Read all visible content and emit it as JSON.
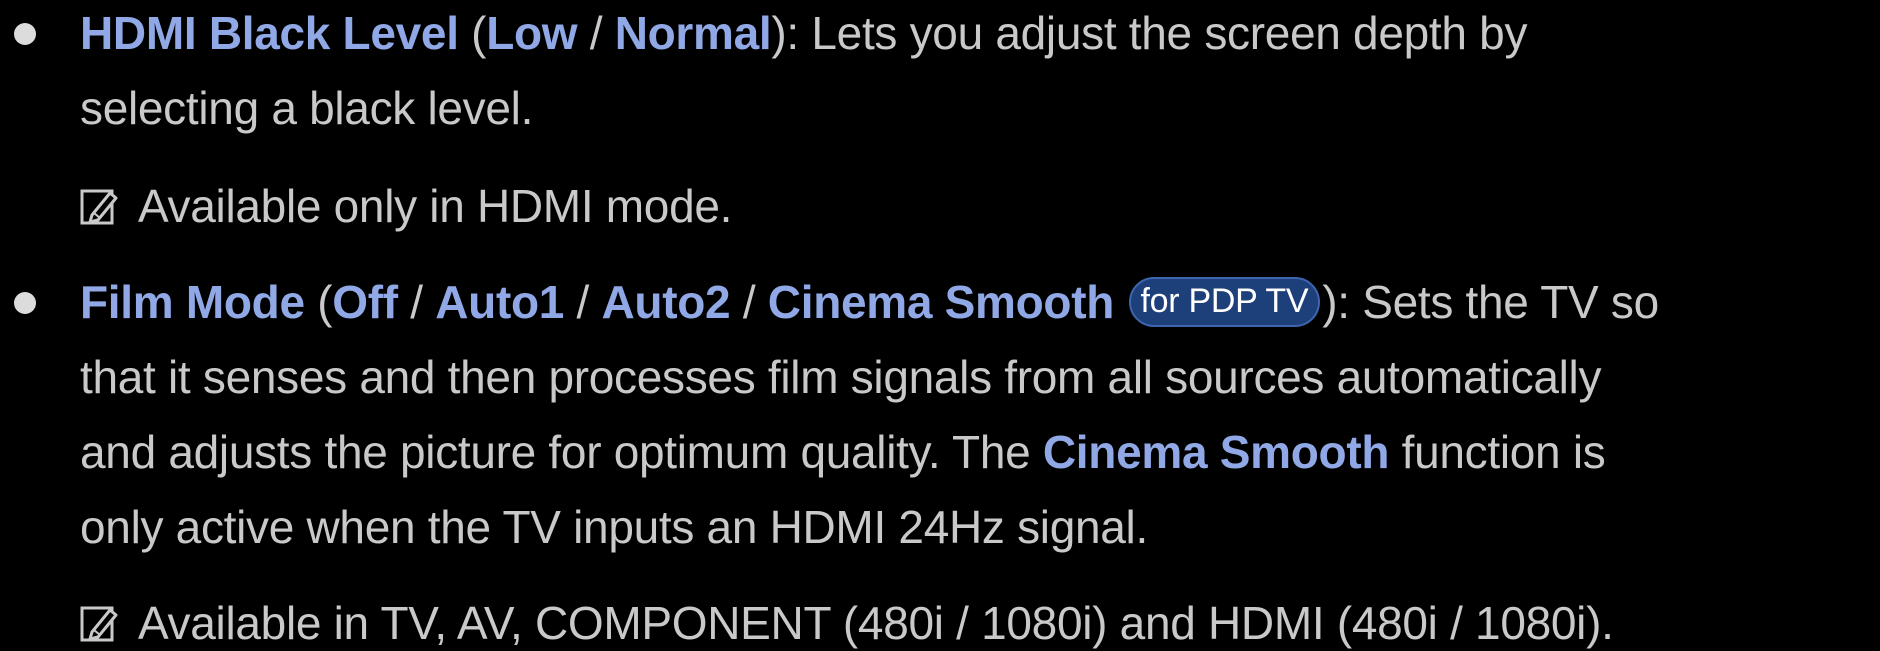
{
  "item1": {
    "title": "HDMI Black Level",
    "open": " (",
    "opt1": "Low",
    "sep1": " / ",
    "opt2": "Normal",
    "rest_line1": "): Lets you adjust the screen depth by",
    "line2": "selecting a black level."
  },
  "note1": {
    "icon": "note-pencil-icon",
    "text": "Available only in HDMI mode."
  },
  "item2": {
    "title": "Film Mode",
    "open": " (",
    "opt1": "Off",
    "sep1": " / ",
    "opt2": "Auto1",
    "sep2": " / ",
    "opt3": "Auto2",
    "sep3": " / ",
    "opt4": "Cinema Smooth",
    "badge": "for PDP TV",
    "rest_line1": "): Sets the TV so",
    "line2": "that it senses and then processes film signals from all sources automatically",
    "line3_pre": "and adjusts the picture for optimum quality. The ",
    "line3_hl": "Cinema Smooth",
    "line3_post": " function is",
    "line4": "only active when the TV inputs an HDMI 24Hz signal."
  },
  "note2": {
    "icon": "note-pencil-icon",
    "text": "Available in TV, AV, COMPONENT (480i / 1080i) and HDMI (480i / 1080i)."
  },
  "colors": {
    "background": "#000000",
    "text": "#c9c9c9",
    "highlight": "#90a8e6",
    "badge_bg": "#1d3f7a"
  }
}
